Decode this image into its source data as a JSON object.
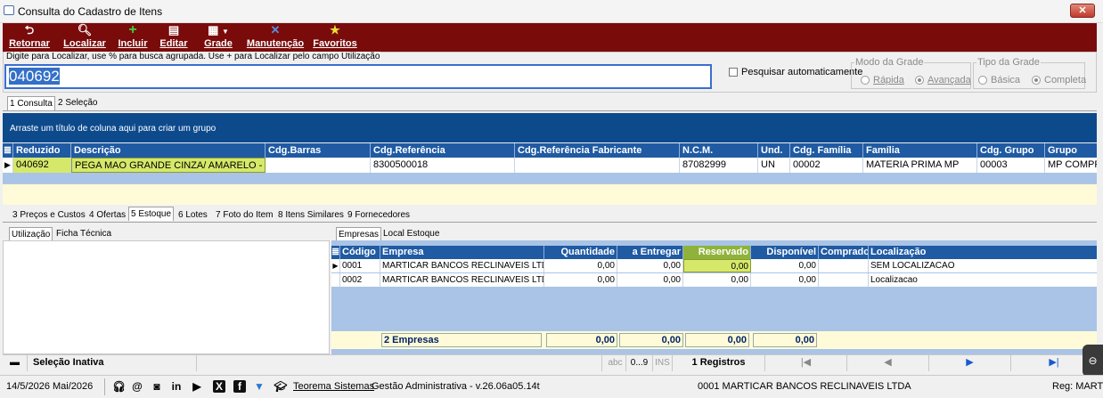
{
  "window": {
    "title": "Consulta do Cadastro de Itens",
    "close_label": "✕"
  },
  "toolbar": {
    "retornar": "Retornar",
    "localizar": "Localizar",
    "incluir": "Incluir",
    "editar": "Editar",
    "grade": "Grade",
    "manutencao": "Manutenção",
    "favoritos": "Favoritos"
  },
  "search": {
    "legend": "Digite para Localizar, use % para busca agrupada. Use + para Localizar pelo campo Utilização",
    "value": "040692",
    "auto_label": "Pesquisar automaticamente"
  },
  "modo_grade": {
    "legend": "Modo da Grade",
    "opt1": "Rápida",
    "opt2": "Avançada",
    "selected": "Avançada"
  },
  "tipo_grade": {
    "legend": "Tipo da Grade",
    "opt1": "Básica",
    "opt2": "Completa",
    "selected": "Completa"
  },
  "main_tabs": [
    "1 Consulta",
    "2 Seleção"
  ],
  "grid": {
    "group_hint": "Arraste um título de coluna aqui para criar um grupo",
    "columns": [
      "Reduzido",
      "Descrição",
      "Cdg.Barras",
      "Cdg.Referência",
      "Cdg.Referência Fabricante",
      "N.C.M.",
      "Und.",
      "Cdg. Família",
      "Família",
      "Cdg. Grupo",
      "Grupo"
    ],
    "row": [
      "040692",
      "PEGA MAO GRANDE CINZA/ AMARELO - GLOV",
      "",
      "8300500018",
      "",
      "87082999",
      "UN",
      "00002",
      "MATERIA PRIMA MP",
      "00003",
      "MP COMPRA"
    ]
  },
  "detail_tabs": [
    "3 Preços e Custos",
    "4 Ofertas",
    "5 Estoque",
    "6 Lotes",
    "7 Foto do Item",
    "8 Itens Similares",
    "9 Fornecedores"
  ],
  "left_tabs": [
    "Utilização",
    "Ficha Técnica"
  ],
  "stock_tabs": [
    "Empresas",
    "Local Estoque"
  ],
  "stock": {
    "columns": [
      "Código",
      "Empresa",
      "Quantidade",
      "a Entregar",
      "Reservado",
      "Disponível",
      "Comprado",
      "Localização"
    ],
    "rows": [
      [
        "0001",
        "MARTICAR BANCOS RECLINAVEIS LTD",
        "0,00",
        "0,00",
        "0,00",
        "0,00",
        "",
        "SEM LOCALIZACAO"
      ],
      [
        "0002",
        "MARTICAR BANCOS RECLINAVEIS LTD",
        "0,00",
        "0,00",
        "0,00",
        "0,00",
        "",
        "Localizacao"
      ]
    ],
    "footer": {
      "count": "2 Empresas",
      "quantidade": "0,00",
      "entregar": "0,00",
      "reservado": "0,00",
      "disponivel": "0,00"
    }
  },
  "status": {
    "selecao": "Seleção Inativa",
    "abc": "abc",
    "num": "0...9",
    "ins": "INS",
    "registros": "1 Registros",
    "first": "|◀",
    "prev": "◀",
    "next": "▶",
    "last": "▶|"
  },
  "footer": {
    "date": "14/5/2026 Mai/2026",
    "company_link": "Teorema Sistemas",
    "app": "Gestão Administrativa - v.26.06a05.14t",
    "company": "0001 MARTICAR BANCOS RECLINAVEIS LTDA",
    "reg": "Reg: MART"
  },
  "colors": {
    "toolbar": "#7a0b0b",
    "grid_header": "#1f5aa3",
    "group_bar": "#0d4a8c",
    "highlight": "#d6e86a",
    "footer_yellow": "#fffbd8"
  }
}
